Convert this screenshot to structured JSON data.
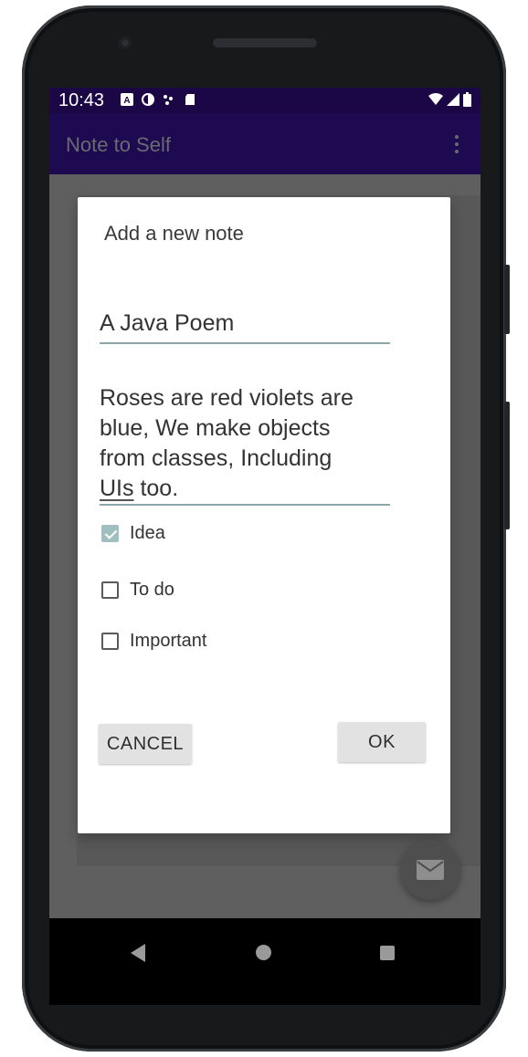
{
  "status_bar": {
    "time": "10:43",
    "left_icons": [
      "a-icon",
      "half-circle-icon",
      "dots-icon",
      "sd-card-icon"
    ],
    "right_icons": [
      "wifi-icon",
      "signal-icon",
      "battery-icon"
    ]
  },
  "app_bar": {
    "title": "Note to Self",
    "menu_icon": "overflow-menu-icon"
  },
  "dialog": {
    "title": "Add a new note",
    "title_field_value": "A Java Poem",
    "body_lines": [
      "Roses are red violets are",
      "blue, We make objects",
      "from classes, Including"
    ],
    "body_last_word_underlined": "UIs",
    "body_last_rest": " too.",
    "checkboxes": [
      {
        "label": "Idea",
        "checked": true
      },
      {
        "label": "To do",
        "checked": false
      },
      {
        "label": "Important",
        "checked": false
      }
    ],
    "cancel_label": "CANCEL",
    "ok_label": "OK"
  },
  "fab": {
    "icon": "mail-icon"
  },
  "nav_bar": {
    "icons": [
      "back-icon",
      "home-icon",
      "recents-icon"
    ]
  },
  "colors": {
    "status_bar": "#1b0746",
    "app_bar": "#1e0a50",
    "accent_checkbox": "#9fbfc0",
    "scrim": "#5f5f5f"
  }
}
